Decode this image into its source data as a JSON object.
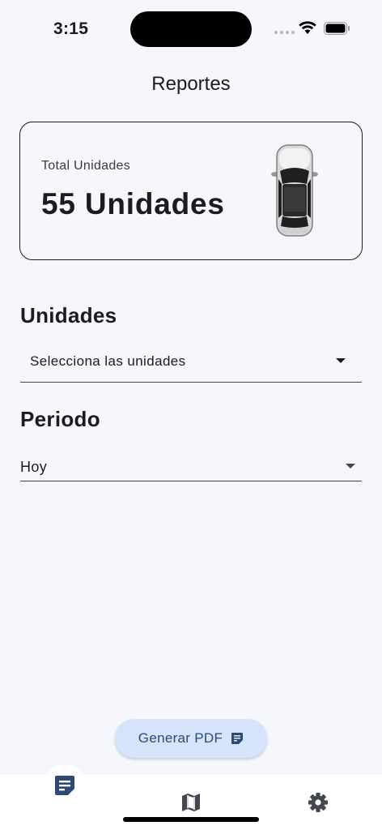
{
  "status": {
    "time": "3:15"
  },
  "appbar": {
    "title": "Reportes"
  },
  "summary": {
    "label": "Total Unidades",
    "value": "55 Unidades",
    "icon": "car-top-view-icon"
  },
  "unidades": {
    "title": "Unidades",
    "placeholder": "Selecciona las unidades"
  },
  "periodo": {
    "title": "Periodo",
    "selected": "Hoy"
  },
  "actions": {
    "generate_pdf": "Generar PDF",
    "icon": "note-icon"
  },
  "bottom_nav": {
    "items": [
      {
        "icon": "report-note-icon",
        "active": true
      },
      {
        "icon": "map-icon",
        "active": false
      },
      {
        "icon": "gear-icon",
        "active": false
      }
    ]
  },
  "colors": {
    "background": "#f6f6fd",
    "accent": "#2d4a75",
    "button_bg": "#d5e3fb",
    "text": "#1d1b20"
  }
}
